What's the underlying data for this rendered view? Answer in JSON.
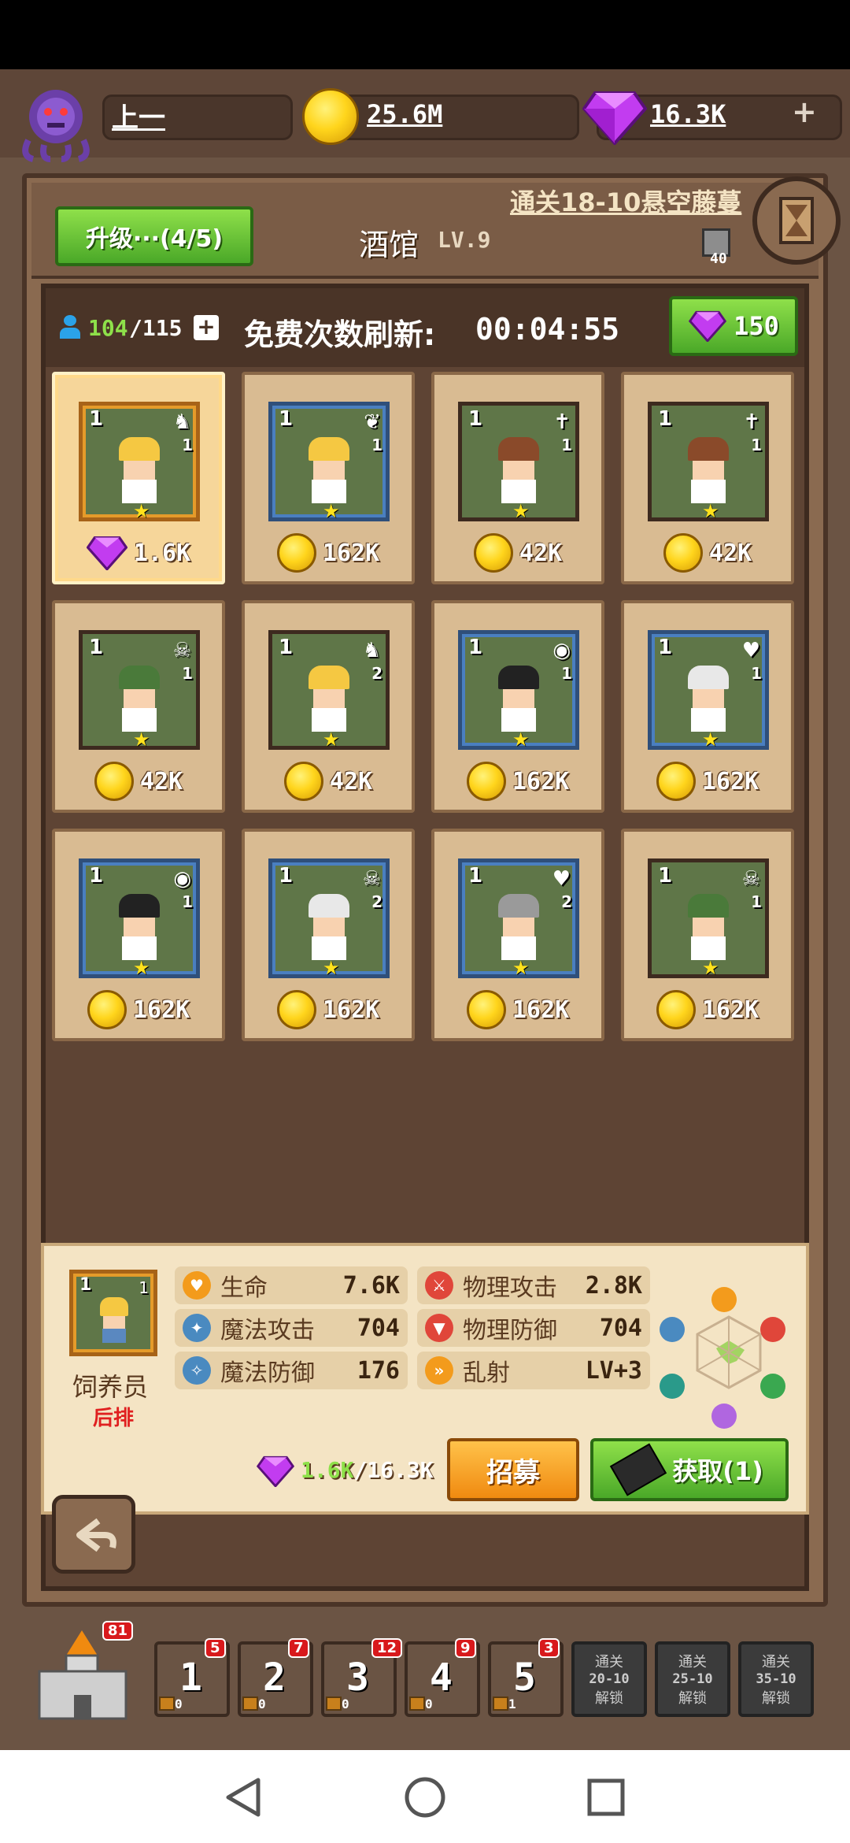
{
  "player": {
    "name": "上一"
  },
  "currency": {
    "gold": "25.6M",
    "gems": "16.3K",
    "add_symbol": "+"
  },
  "quest": {
    "label": "通关18-10悬空藤蔓",
    "badge": "40"
  },
  "upgrade_button": "升级···(4/5)",
  "building": {
    "name": "酒馆",
    "level": "LV.9"
  },
  "capacity": {
    "current": "104",
    "max": "/115",
    "plus": "+"
  },
  "refresh": {
    "label": "免费次数刷新:",
    "timer": "00:04:55"
  },
  "refresh_cost": "150",
  "heroes": [
    {
      "level": "1",
      "count": "1",
      "price": "1.6K",
      "currency": "gem",
      "cls": "♞",
      "selected": true
    },
    {
      "level": "1",
      "count": "1",
      "price": "162K",
      "currency": "gold",
      "cls": "❦"
    },
    {
      "level": "1",
      "count": "1",
      "price": "42K",
      "currency": "gold",
      "cls": "✝"
    },
    {
      "level": "1",
      "count": "1",
      "price": "42K",
      "currency": "gold",
      "cls": "✝"
    },
    {
      "level": "1",
      "count": "1",
      "price": "42K",
      "currency": "gold",
      "cls": "☠"
    },
    {
      "level": "1",
      "count": "2",
      "price": "42K",
      "currency": "gold",
      "cls": "♞"
    },
    {
      "level": "1",
      "count": "1",
      "price": "162K",
      "currency": "gold",
      "cls": "◉"
    },
    {
      "level": "1",
      "count": "1",
      "price": "162K",
      "currency": "gold",
      "cls": "♥"
    },
    {
      "level": "1",
      "count": "1",
      "price": "162K",
      "currency": "gold",
      "cls": "◉"
    },
    {
      "level": "1",
      "count": "2",
      "price": "162K",
      "currency": "gold",
      "cls": "☠"
    },
    {
      "level": "1",
      "count": "2",
      "price": "162K",
      "currency": "gold",
      "cls": "♥"
    },
    {
      "level": "1",
      "count": "1",
      "price": "162K",
      "currency": "gold",
      "cls": "☠"
    }
  ],
  "selected_hero": {
    "level": "1",
    "count": "1",
    "name": "饲养员",
    "position": "后排",
    "stats": [
      {
        "label": "生命",
        "value": "7.6K"
      },
      {
        "label": "物理攻击",
        "value": "2.8K"
      },
      {
        "label": "魔法攻击",
        "value": "704"
      },
      {
        "label": "物理防御",
        "value": "704"
      },
      {
        "label": "魔法防御",
        "value": "176"
      },
      {
        "label": "乱射",
        "value": "LV+3"
      }
    ],
    "cost": "1.6K",
    "cost_total": "/16.3K",
    "recruit": "招募",
    "obtain": "获取(1)"
  },
  "bottom": {
    "castle_badge": "81",
    "slots": [
      {
        "num": "1",
        "badge": "5",
        "sub": "0"
      },
      {
        "num": "2",
        "badge": "7",
        "sub": "0"
      },
      {
        "num": "3",
        "badge": "12",
        "sub": "0"
      },
      {
        "num": "4",
        "badge": "9",
        "sub": "0"
      },
      {
        "num": "5",
        "badge": "3",
        "sub": "1"
      }
    ],
    "locked": [
      {
        "line1": "通关",
        "line2": "20-10",
        "line3": "解锁"
      },
      {
        "line1": "通关",
        "line2": "25-10",
        "line3": "解锁"
      },
      {
        "line1": "通关",
        "line2": "35-10",
        "line3": "解锁"
      }
    ]
  },
  "colors": {
    "accent_green": "#5bbf2c",
    "accent_orange": "#f5a020",
    "gem_purple": "#c23cf0",
    "gold": "#ffd51c"
  }
}
